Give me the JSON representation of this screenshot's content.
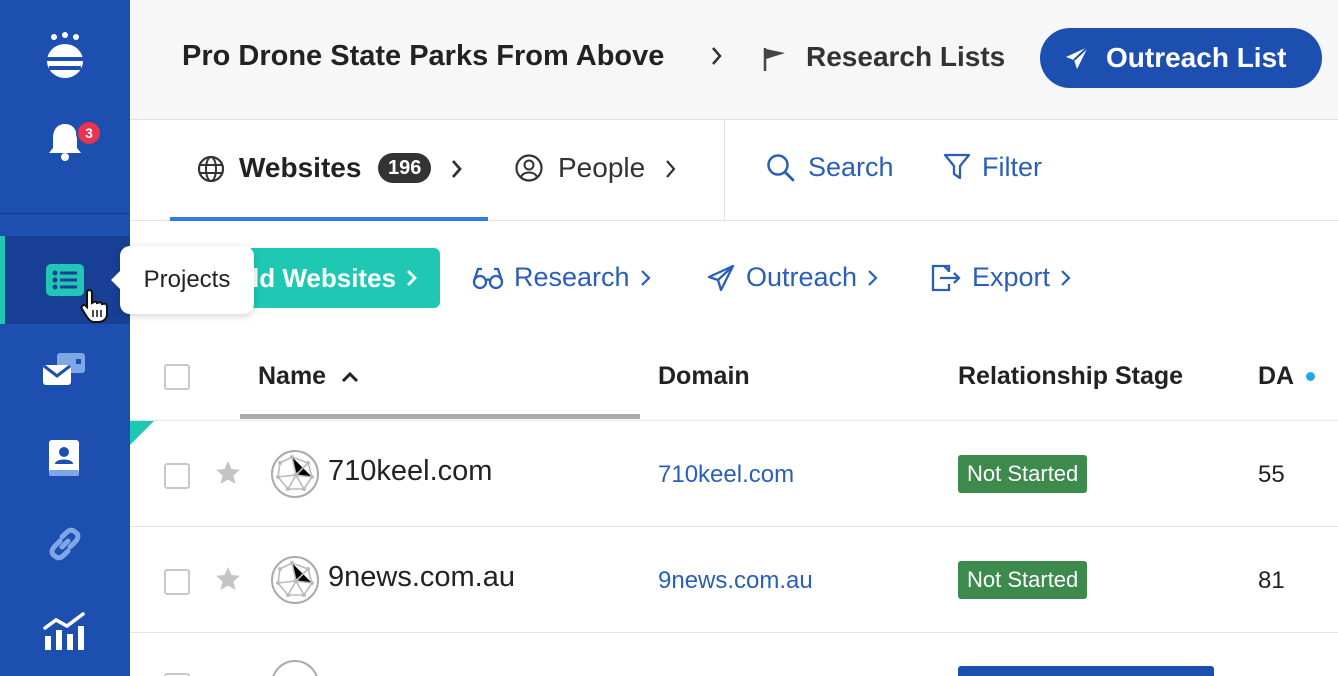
{
  "sidebar": {
    "notification_count": "3",
    "tooltip": "Projects"
  },
  "header": {
    "project_name": "Pro Drone State Parks From Above",
    "research_lists_label": "Research Lists",
    "outreach_list_button": "Outreach List"
  },
  "tabs": {
    "websites_label": "Websites",
    "websites_count": "196",
    "people_label": "People",
    "search_label": "Search",
    "filter_label": "Filter"
  },
  "toolbar": {
    "add_websites_label": "Add Websites",
    "research_label": "Research",
    "outreach_label": "Outreach",
    "export_label": "Export"
  },
  "table": {
    "columns": [
      "Name",
      "Domain",
      "Relationship Stage",
      "DA"
    ],
    "rows": [
      {
        "name": "710keel.com",
        "domain": "710keel.com",
        "stage": "Not Started",
        "da": "55"
      },
      {
        "name": "9news.com.au",
        "domain": "9news.com.au",
        "stage": "Not Started",
        "da": "81"
      }
    ]
  },
  "colors": {
    "sidebar": "#1d4fb0",
    "accent_teal": "#1fc8b3",
    "link_blue": "#2a5fb8",
    "stage_green": "#3d8a4d"
  }
}
